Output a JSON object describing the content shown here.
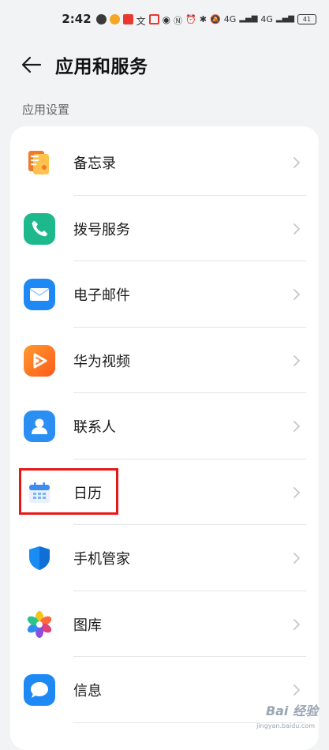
{
  "status_bar": {
    "time": "2:42",
    "signal_text_1": "4G",
    "signal_text_2": "4G",
    "battery": "41"
  },
  "header": {
    "title": "应用和服务"
  },
  "section": {
    "label": "应用设置"
  },
  "items": [
    {
      "label": "备忘录",
      "icon": "notes-icon",
      "color": "#f5a623"
    },
    {
      "label": "拨号服务",
      "icon": "phone-icon",
      "color": "#1fbf8f"
    },
    {
      "label": "电子邮件",
      "icon": "mail-icon",
      "color": "#1e88f5"
    },
    {
      "label": "华为视频",
      "icon": "video-icon",
      "color": "#ff6d1a"
    },
    {
      "label": "联系人",
      "icon": "contacts-icon",
      "color": "#2b8ef2"
    },
    {
      "label": "日历",
      "icon": "calendar-icon",
      "color": "#3f8cf0"
    },
    {
      "label": "手机管家",
      "icon": "shield-icon",
      "color": "#1a8df5"
    },
    {
      "label": "图库",
      "icon": "gallery-icon",
      "color": "#f5a623"
    },
    {
      "label": "信息",
      "icon": "message-icon",
      "color": "#1e88f5"
    }
  ],
  "watermark": {
    "text": "Bai  经验",
    "sub": "jingyan.baidu.com"
  },
  "colors": {
    "highlight": "#e81818",
    "background": "#f1f3f5"
  }
}
